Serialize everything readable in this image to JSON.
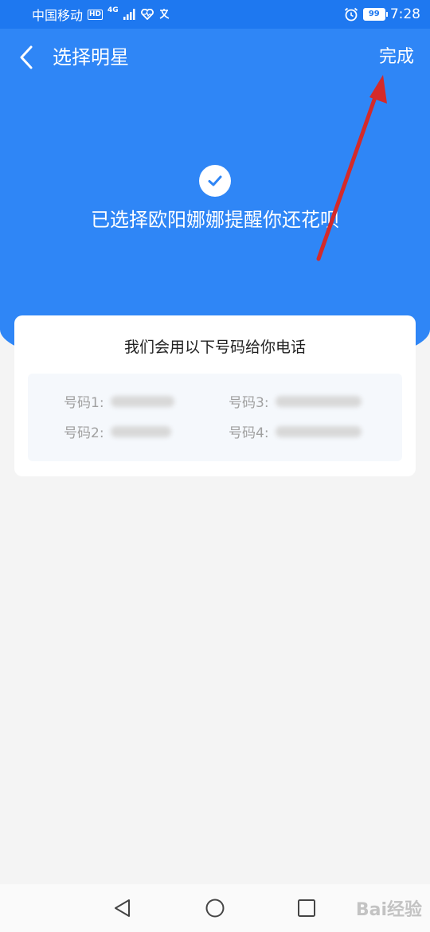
{
  "status_bar": {
    "carrier": "中国移动",
    "hd_badge": "HD",
    "network": "4G",
    "battery": "99",
    "time": "7:28"
  },
  "header": {
    "title": "选择明星",
    "done_label": "完成"
  },
  "hero": {
    "message": "已选择欧阳娜娜提醒你还花呗"
  },
  "card": {
    "title": "我们会用以下号码给你电话",
    "numbers": [
      {
        "label": "号码1:"
      },
      {
        "label": "号码2:"
      },
      {
        "label": "号码3:"
      },
      {
        "label": "号码4:"
      }
    ]
  },
  "colors": {
    "primary_blue": "#2f86f6",
    "status_blue": "#1e78f0",
    "annotation_red": "#d42a2a"
  },
  "watermark": {
    "text": "Bai经验"
  }
}
